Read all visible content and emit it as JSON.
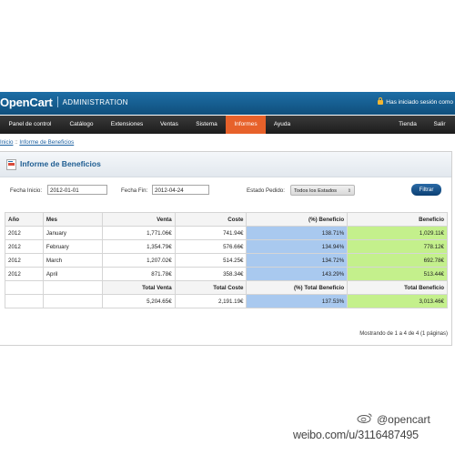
{
  "header": {
    "logo": "OpenCart",
    "logo_sub": "ADMINISTRATION",
    "login_text": "Has iniciado sesión como"
  },
  "menu": {
    "items": [
      {
        "label": "Panel de control"
      },
      {
        "label": "Catálogo"
      },
      {
        "label": "Extensiones"
      },
      {
        "label": "Ventas"
      },
      {
        "label": "Sistema"
      },
      {
        "label": "Informes",
        "active": true
      },
      {
        "label": "Ayuda"
      }
    ],
    "right_items": [
      {
        "label": "Tienda"
      },
      {
        "label": "Salir"
      }
    ]
  },
  "breadcrumb": {
    "home": "Inicio",
    "separator": "::",
    "current": "Informe de Beneficios"
  },
  "report": {
    "title": "Informe de Beneficios",
    "filters": {
      "start_label": "Fecha Inicio:",
      "start_value": "2012-01-01",
      "end_label": "Fecha Fin:",
      "end_value": "2012-04-24",
      "status_label": "Estado Pedido:",
      "status_value": "Todos los Estados",
      "filter_button": "Filtrar"
    },
    "table": {
      "headers": [
        "Año",
        "Mes",
        "Venta",
        "Coste",
        "(%) Beneficio",
        "Beneficio"
      ],
      "rows": [
        [
          "2012",
          "January",
          "1,771.06€",
          "741.94€",
          "138.71%",
          "1,029.11€"
        ],
        [
          "2012",
          "February",
          "1,354.79€",
          "576.66€",
          "134.94%",
          "778.12€"
        ],
        [
          "2012",
          "March",
          "1,207.02€",
          "514.25€",
          "134.72%",
          "692.78€"
        ],
        [
          "2012",
          "April",
          "871.78€",
          "358.34€",
          "143.29%",
          "513.44€"
        ]
      ],
      "totals_headers": [
        "Total Venta",
        "Total Coste",
        "(%) Total Beneficio",
        "Total Beneficio"
      ],
      "totals": [
        "5,204.65€",
        "2,191.19€",
        "137.53%",
        "3,013.46€"
      ]
    },
    "pagination": "Mostrando de 1 a 4 de 4 (1 páginas)"
  },
  "watermark": {
    "handle": "@opencart",
    "url": "weibo.com/u/3116487495"
  },
  "colors": {
    "header_blue": "#1d6ea6",
    "menu_active": "#e7612a",
    "percent_cell": "#a9c9ef",
    "profit_cell": "#c4f08c",
    "button_blue": "#0b3f73"
  }
}
